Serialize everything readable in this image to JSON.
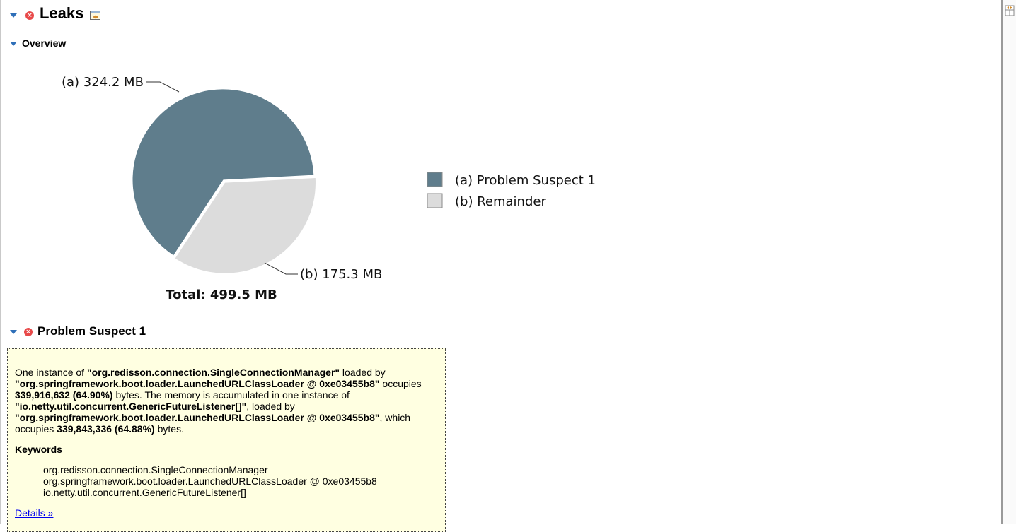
{
  "header": {
    "title": "Leaks"
  },
  "overview": {
    "title": "Overview",
    "total_label": "Total: 499.5 MB"
  },
  "chart_data": {
    "type": "pie",
    "slices": [
      {
        "id": "(a)",
        "name": "Problem Suspect 1",
        "value_mb": 324.2,
        "label": "(a)  324.2 MB",
        "color": "#5f7d8c"
      },
      {
        "id": "(b)",
        "name": "Remainder",
        "value_mb": 175.3,
        "label": "(b)  175.3 MB",
        "color": "#dcdcdc"
      }
    ],
    "total_mb": 499.5,
    "legend": [
      {
        "label": "(a)  Problem Suspect 1",
        "color": "#5f7d8c"
      },
      {
        "label": "(b)  Remainder",
        "color": "#dcdcdc"
      }
    ],
    "legend_position": "right"
  },
  "suspect": {
    "title": "Problem Suspect 1",
    "description": {
      "p1": "One instance of ",
      "b1": "\"org.redisson.connection.SingleConnectionManager\"",
      "p2": " loaded by ",
      "b2": "\"org.springframework.boot.loader.LaunchedURLClassLoader @ 0xe03455b8\"",
      "p3": " occupies ",
      "b3": "339,916,632 (64.90%)",
      "p4": " bytes. The memory is accumulated in one instance of ",
      "b4": "\"io.netty.util.concurrent.GenericFutureListener[]\"",
      "p5": ", loaded by ",
      "b5": "\"org.springframework.boot.loader.LaunchedURLClassLoader @ 0xe03455b8\"",
      "p6": ", which occupies ",
      "b6": "339,843,336 (64.88%)",
      "p7": " bytes."
    },
    "keywords_title": "Keywords",
    "keywords": [
      "org.redisson.connection.SingleConnectionManager",
      "org.springframework.boot.loader.LaunchedURLClassLoader @ 0xe03455b8",
      "io.netty.util.concurrent.GenericFutureListener[]"
    ],
    "details_link": "Details »"
  },
  "colors": {
    "suspect_slice": "#5f7d8c",
    "remainder_slice": "#dcdcdc",
    "box_background": "#ffffe1",
    "link": "#0000ee",
    "error_icon": "#e84a4a"
  }
}
